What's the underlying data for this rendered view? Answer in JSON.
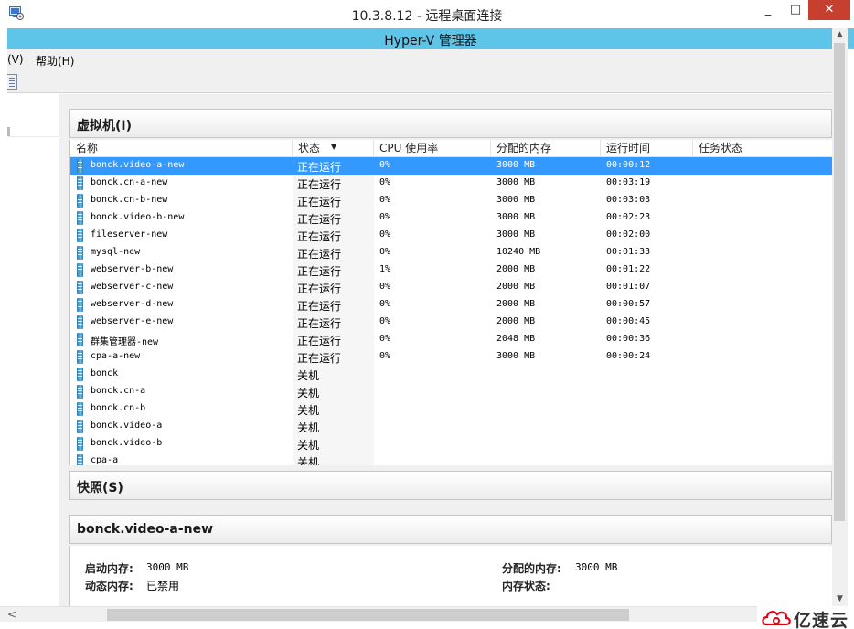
{
  "window": {
    "title": "10.3.8.12 - 远程桌面连接",
    "min": "_",
    "max": "□",
    "close": "✕"
  },
  "app": {
    "title": "Hyper-V 管理器"
  },
  "menu": [
    {
      "label": "(V)"
    },
    {
      "label": "帮助(H)"
    }
  ],
  "vm_section": {
    "title": "虚拟机(I)",
    "columns": [
      "名称",
      "状态",
      "CPU 使用率",
      "分配的内存",
      "运行时间",
      "任务状态"
    ],
    "rows": [
      {
        "name": "bonck.video-a-new",
        "status": "正在运行",
        "cpu": "0%",
        "mem": "3000 MB",
        "uptime": "00:00:12",
        "selected": true
      },
      {
        "name": "bonck.cn-a-new",
        "status": "正在运行",
        "cpu": "0%",
        "mem": "3000 MB",
        "uptime": "00:03:19"
      },
      {
        "name": "bonck.cn-b-new",
        "status": "正在运行",
        "cpu": "0%",
        "mem": "3000 MB",
        "uptime": "00:03:03"
      },
      {
        "name": "bonck.video-b-new",
        "status": "正在运行",
        "cpu": "0%",
        "mem": "3000 MB",
        "uptime": "00:02:23"
      },
      {
        "name": "fileserver-new",
        "status": "正在运行",
        "cpu": "0%",
        "mem": "3000 MB",
        "uptime": "00:02:00"
      },
      {
        "name": "mysql-new",
        "status": "正在运行",
        "cpu": "0%",
        "mem": "10240 MB",
        "uptime": "00:01:33"
      },
      {
        "name": "webserver-b-new",
        "status": "正在运行",
        "cpu": "1%",
        "mem": "2000 MB",
        "uptime": "00:01:22"
      },
      {
        "name": "webserver-c-new",
        "status": "正在运行",
        "cpu": "0%",
        "mem": "2000 MB",
        "uptime": "00:01:07"
      },
      {
        "name": "webserver-d-new",
        "status": "正在运行",
        "cpu": "0%",
        "mem": "2000 MB",
        "uptime": "00:00:57"
      },
      {
        "name": "webserver-e-new",
        "status": "正在运行",
        "cpu": "0%",
        "mem": "2000 MB",
        "uptime": "00:00:45"
      },
      {
        "name": "群集管理器-new",
        "status": "正在运行",
        "cpu": "0%",
        "mem": "2048 MB",
        "uptime": "00:00:36"
      },
      {
        "name": "cpa-a-new",
        "status": "正在运行",
        "cpu": "0%",
        "mem": "3000 MB",
        "uptime": "00:00:24"
      },
      {
        "name": "bonck",
        "status": "关机",
        "cpu": "",
        "mem": "",
        "uptime": ""
      },
      {
        "name": "bonck.cn-a",
        "status": "关机",
        "cpu": "",
        "mem": "",
        "uptime": ""
      },
      {
        "name": "bonck.cn-b",
        "status": "关机",
        "cpu": "",
        "mem": "",
        "uptime": ""
      },
      {
        "name": "bonck.video-a",
        "status": "关机",
        "cpu": "",
        "mem": "",
        "uptime": ""
      },
      {
        "name": "bonck.video-b",
        "status": "关机",
        "cpu": "",
        "mem": "",
        "uptime": ""
      },
      {
        "name": "cpa-a",
        "status": "关机",
        "cpu": "",
        "mem": "",
        "uptime": ""
      }
    ]
  },
  "snapshot_section": {
    "title": "快照(S)"
  },
  "detail": {
    "title": "bonck.video-a-new",
    "startup_memory_label": "启动内存:",
    "startup_memory": "3000 MB",
    "dynamic_memory_label": "动态内存:",
    "dynamic_memory": "已禁用",
    "assigned_memory_label": "分配的内存:",
    "assigned_memory": "3000 MB",
    "memory_status_label": "内存状态:"
  },
  "scroll": {
    "left": "<",
    "up": "▲",
    "down": "▼"
  },
  "watermark": {
    "text": "亿速云"
  },
  "colors": {
    "selection": "#3399ff",
    "hyperv_bar": "#5fc5e8",
    "close_button": "#c7402f",
    "watermark": "#e60012"
  }
}
